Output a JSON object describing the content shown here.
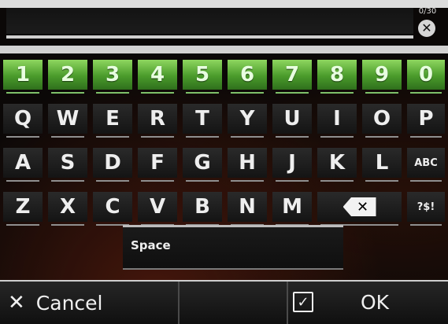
{
  "input": {
    "counter": "0/30",
    "clear_glyph": "✕",
    "value": ""
  },
  "keys": {
    "numbers": [
      "1",
      "2",
      "3",
      "4",
      "5",
      "6",
      "7",
      "8",
      "9",
      "0"
    ],
    "row1": [
      "Q",
      "W",
      "E",
      "R",
      "T",
      "Y",
      "U",
      "I",
      "O",
      "P"
    ],
    "row2": [
      "A",
      "S",
      "D",
      "F",
      "G",
      "H",
      "J",
      "K",
      "L"
    ],
    "row2_mode": "ABC",
    "row3": [
      "Z",
      "X",
      "C",
      "V",
      "B",
      "N",
      "M"
    ],
    "backspace_glyph": "✕",
    "row3_mode": "?$!",
    "space_label": "Space"
  },
  "footer": {
    "cancel_icon": "✕",
    "cancel_label": "Cancel",
    "ok_icon": "☑",
    "ok_label": "OK"
  },
  "icons": {
    "clear": "clear-icon",
    "backspace": "backspace-icon",
    "cancel": "close-icon",
    "ok": "checkbox-icon"
  },
  "colors": {
    "number_row": "#4a9b2b",
    "background": "#0b0807",
    "text": "#eeeeee"
  }
}
